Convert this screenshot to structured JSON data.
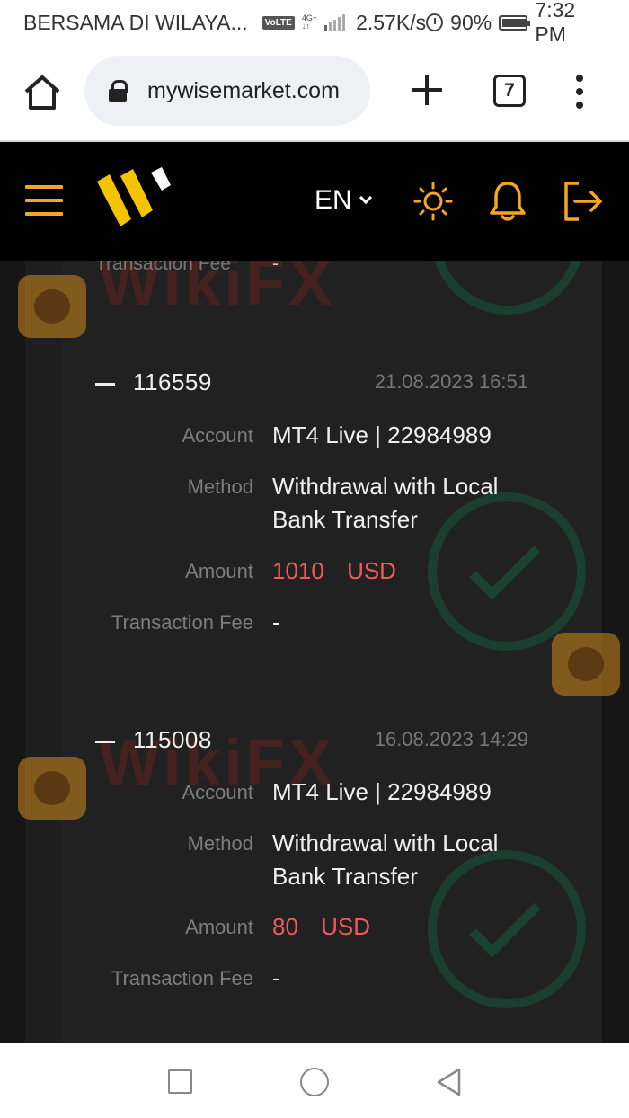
{
  "statusbar": {
    "carrier": "BERSAMA DI WILAYA...",
    "volte": "VoLTE",
    "network": "4G+",
    "speed": "2.57K/s",
    "battery": "90%",
    "time": "7:32 PM"
  },
  "browser": {
    "url": "mywisemarket.com",
    "tab_count": "7"
  },
  "header": {
    "language": "EN"
  },
  "partial_row": {
    "label": "Transaction Fee",
    "value": "-"
  },
  "transactions": [
    {
      "id": "116559",
      "date": "21.08.2023 16:51",
      "account_label": "Account",
      "account": "MT4 Live | 22984989",
      "method_label": "Method",
      "method_line1": "Withdrawal with Local",
      "method_line2": "Bank Transfer",
      "amount_label": "Amount",
      "amount": "1010 USD",
      "fee_label": "Transaction Fee",
      "fee": "-"
    },
    {
      "id": "115008",
      "date": "16.08.2023 14:29",
      "account_label": "Account",
      "account": "MT4 Live | 22984989",
      "method_label": "Method",
      "method_line1": "Withdrawal with Local",
      "method_line2": "Bank Transfer",
      "amount_label": "Amount",
      "amount": "80 USD",
      "fee_label": "Transaction Fee",
      "fee": "-"
    }
  ],
  "watermark": "WikiFX",
  "colors": {
    "accent": "#f5a623",
    "amount": "#ef5b5b",
    "header_bg": "#000000",
    "panel_bg": "#212121"
  },
  "icons": [
    "home-icon",
    "lock-icon",
    "plus-icon",
    "tabs-icon",
    "overflow-menu-icon",
    "hamburger-icon",
    "sun-icon",
    "bell-icon",
    "logout-icon",
    "chevron-down-icon",
    "nav-recents-icon",
    "nav-home-icon",
    "nav-back-icon"
  ]
}
